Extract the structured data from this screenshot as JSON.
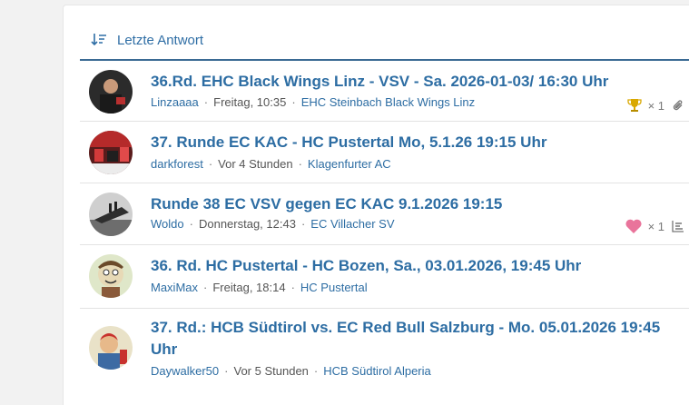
{
  "header": {
    "sort_label": "Letzte Antwort"
  },
  "threads": [
    {
      "title": "36.Rd. EHC Black Wings Linz - VSV - Sa. 2026-01-03/ 16:30 Uhr",
      "author": "Linzaaaa",
      "time": "Freitag, 10:35",
      "forum": "EHC Steinbach Black Wings Linz",
      "reaction_icon": "trophy-icon",
      "reaction_count": "× 1",
      "extra_icon": "paperclip-icon"
    },
    {
      "title": "37. Runde EC KAC - HC Pustertal Mo, 5.1.26 19:15 Uhr",
      "author": "darkforest",
      "time": "Vor 4 Stunden",
      "forum": "Klagenfurter AC"
    },
    {
      "title": "Runde 38 EC VSV gegen EC KAC 9.1.2026 19:15",
      "author": "Woldo",
      "time": "Donnerstag, 12:43",
      "forum": "EC Villacher SV",
      "reaction_icon": "heart-icon",
      "reaction_count": "× 1",
      "extra_icon": "poll-icon"
    },
    {
      "title": "36. Rd. HC Pustertal - HC Bozen, Sa., 03.01.2026, 19:45 Uhr",
      "author": "MaxiMax",
      "time": "Freitag, 18:14",
      "forum": "HC Pustertal"
    },
    {
      "title": "37. Rd.: HCB Südtirol vs. EC Red Bull Salzburg - Mo. 05.01.2026 19:45 Uhr",
      "author": "Daywalker50",
      "time": "Vor 5 Stunden",
      "forum": "HCB Südtirol Alperia"
    }
  ],
  "colors": {
    "link": "#2d6da3",
    "accent_border": "#3a6a94",
    "heart": "#e9749b",
    "trophy": "#d9a800"
  }
}
